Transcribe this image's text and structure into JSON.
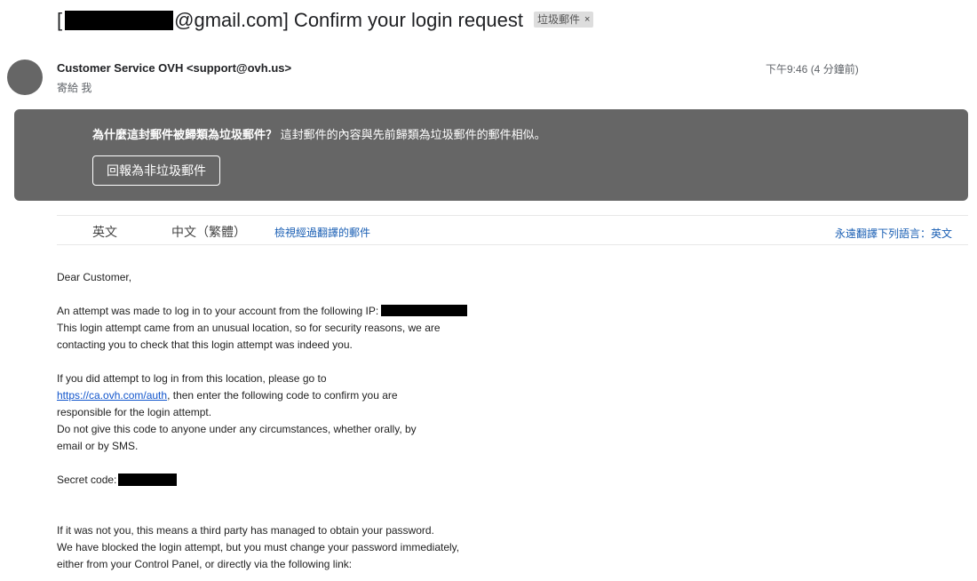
{
  "email": {
    "subject_prefix": "[",
    "subject_suffix": "@gmail.com] Confirm your login request",
    "label_chip": "垃圾郵件",
    "label_remove": "×",
    "sender": "Customer Service OVH <support@ovh.us>",
    "recipient_line": "寄給 我",
    "time": "下午9:46 (4 分鐘前)"
  },
  "spam_banner": {
    "question": "為什麼這封郵件被歸類為垃圾郵件？",
    "explanation": "這封郵件的內容與先前歸類為垃圾郵件的郵件相似。",
    "report_button": "回報為非垃圾郵件"
  },
  "translate_bar": {
    "source_lang": "英文",
    "target_lang": "中文（繁體）",
    "view_translated": "檢視經過翻譯的郵件",
    "always_translate": "永遠翻譯下列語言：英文"
  },
  "body": {
    "greeting": "Dear Customer,",
    "p1_l1": "An attempt was made to log in to your account from the following IP:",
    "p1_l2": "This login attempt came from an unusual location, so for security reasons, we are",
    "p1_l3": "contacting you to check that this login attempt was indeed you.",
    "p2_l1": "If you did attempt to log in from this location, please go to",
    "p2_link": "https://ca.ovh.com/auth",
    "p2_l2_rest": ", then enter the following code to confirm you are",
    "p2_l3": "responsible for the login attempt.",
    "p2_l4": "Do not give this code to anyone under any circumstances, whether orally, by",
    "p2_l5": "email or by SMS.",
    "secret_label": "Secret code:",
    "p3_l1": "If it was not you, this means a third party has managed to obtain your password.",
    "p3_l2": "We have blocked the login attempt, but you must change your password immediately,",
    "p3_l3": "either from your Control Panel, or directly via the following link:"
  },
  "colors": {
    "banner_bg": "#666666",
    "link": "#1155cc",
    "translate_link": "#1a5fb4",
    "redaction": "#000000"
  }
}
